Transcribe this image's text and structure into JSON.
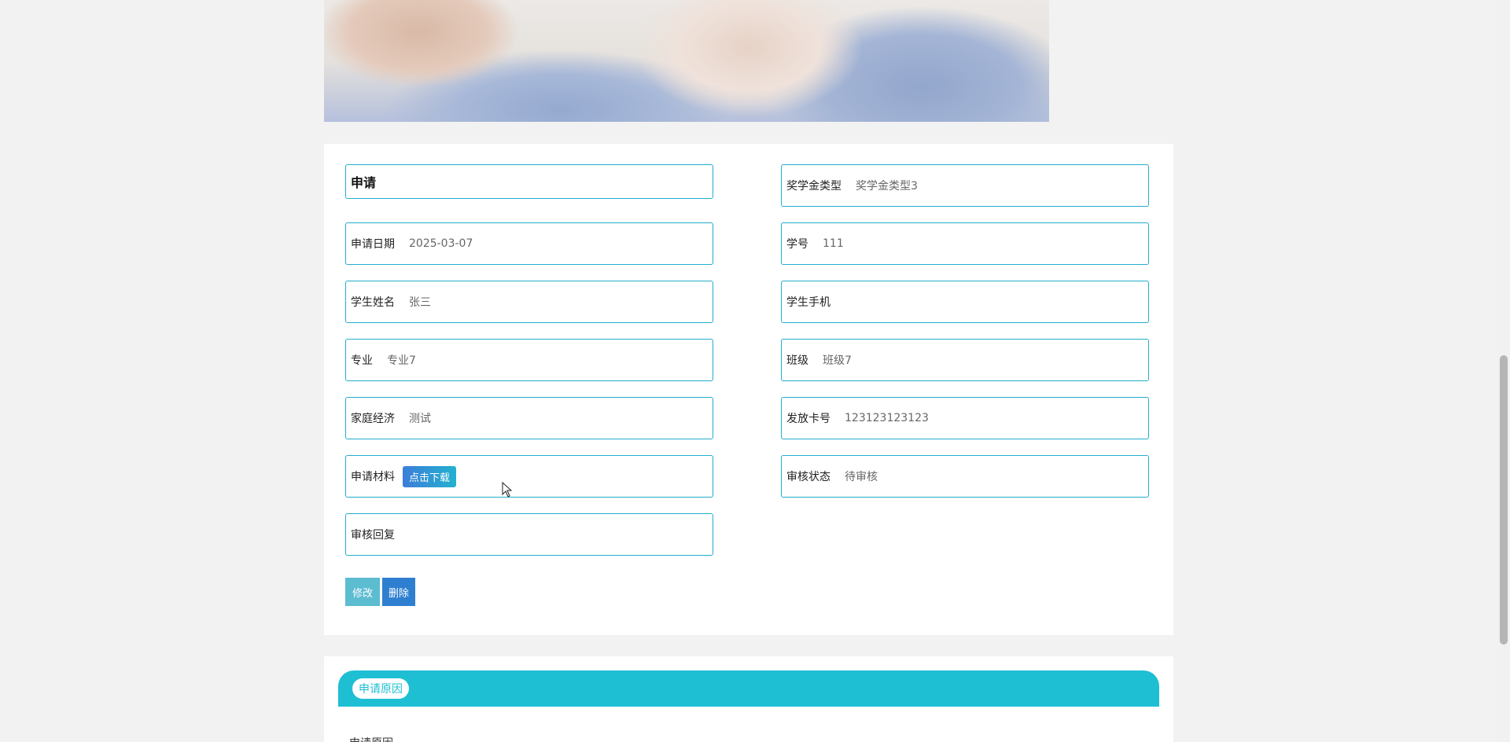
{
  "form": {
    "title": "申请",
    "fields": {
      "scholarship_type": {
        "label": "奖学金类型",
        "value": "奖学金类型3"
      },
      "apply_date": {
        "label": "申请日期",
        "value": "2025-03-07"
      },
      "student_id": {
        "label": "学号",
        "value": "111"
      },
      "student_name": {
        "label": "学生姓名",
        "value": "张三"
      },
      "student_phone": {
        "label": "学生手机",
        "value": ""
      },
      "major": {
        "label": "专业",
        "value": "专业7"
      },
      "class": {
        "label": "班级",
        "value": "班级7"
      },
      "family_economy": {
        "label": "家庭经济",
        "value": "测试"
      },
      "card_number": {
        "label": "发放卡号",
        "value": "123123123123"
      },
      "materials": {
        "label": "申请材料",
        "button": "点击下载"
      },
      "review_status": {
        "label": "审核状态",
        "value": "待审核"
      },
      "review_reply": {
        "label": "审核回复",
        "value": ""
      }
    },
    "actions": {
      "edit_label": "修改",
      "delete_label": "删除"
    }
  },
  "reason_section": {
    "pill": "申请原因",
    "label": "申请原因"
  }
}
